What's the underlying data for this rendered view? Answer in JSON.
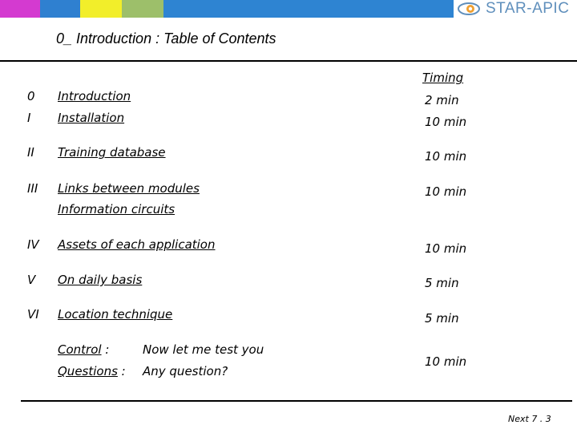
{
  "header": {
    "brand": "STAR-APIC",
    "colors": [
      "#d43ad0",
      "#2f80d0",
      "#f2ee2a",
      "#9dbf6a",
      "#2e84d2"
    ]
  },
  "title": "0_ Introduction : Table of Contents",
  "timing_header": "Timing",
  "rows": [
    {
      "num": "0",
      "topic": "Introduction",
      "time": "2 min"
    },
    {
      "num": "I",
      "topic": "Installation",
      "time": "10 min"
    },
    {
      "num": "II",
      "topic": "Training database",
      "time": "10 min"
    },
    {
      "num": "III",
      "topic": "Links between modules",
      "time": "10 min"
    },
    {
      "num": "",
      "topic": "Information circuits",
      "time": ""
    },
    {
      "num": "IV",
      "topic": "Assets of each application",
      "time": "10 min"
    },
    {
      "num": "V",
      "topic": "On daily basis",
      "time": "5 min"
    },
    {
      "num": "VI",
      "topic": "Location technique",
      "time": "5 min"
    }
  ],
  "closing": {
    "control_label": "Control",
    "control_suffix": " :",
    "control_text": "Now let me test you",
    "questions_label": "Questions",
    "questions_suffix": " :",
    "questions_text": "Any question?",
    "time": "10 min"
  },
  "footer": "Next 7 . 3"
}
